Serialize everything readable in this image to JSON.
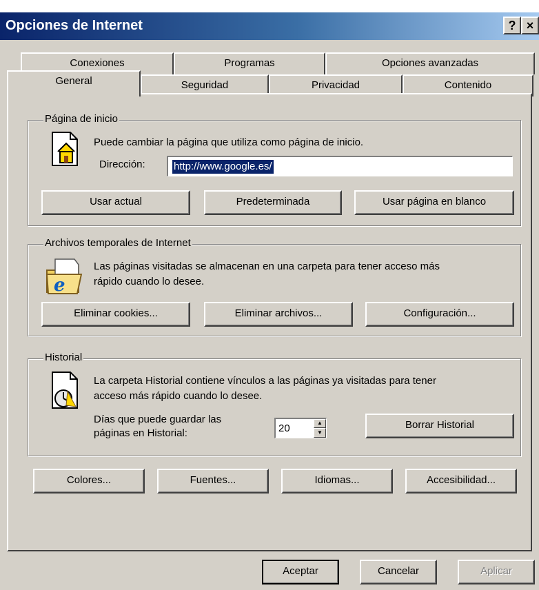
{
  "window": {
    "title": "Opciones de Internet",
    "help_glyph": "?",
    "close_glyph": "×"
  },
  "tabs": {
    "back_row": [
      "Conexiones",
      "Programas",
      "Opciones avanzadas"
    ],
    "front_row": [
      "General",
      "Seguridad",
      "Privacidad",
      "Contenido"
    ],
    "active": "General"
  },
  "home_page": {
    "group_label": "Página de inicio",
    "description": "Puede cambiar la página que utiliza como página de inicio.",
    "address_label": "Dirección:",
    "address_value": "http://www.google.es/",
    "buttons": [
      "Usar actual",
      "Predeterminada",
      "Usar página en blanco"
    ]
  },
  "temp_files": {
    "group_label": "Archivos temporales de Internet",
    "description_line1": "Las páginas visitadas se almacenan en una carpeta para tener acceso más",
    "description_line2": "rápido cuando lo desee.",
    "buttons": [
      "Eliminar cookies...",
      "Eliminar archivos...",
      "Configuración..."
    ]
  },
  "history": {
    "group_label": "Historial",
    "description_line1": "La carpeta Historial contiene vínculos a las páginas ya visitadas para tener",
    "description_line2": "acceso más rápido cuando lo desee.",
    "days_label_line1": "Días que puede guardar las",
    "days_label_line2": "páginas en Historial:",
    "days_value": "20",
    "clear_button": "Borrar Historial"
  },
  "bottom_buttons": [
    "Colores...",
    "Fuentes...",
    "Idiomas...",
    "Accesibilidad..."
  ],
  "dialog_buttons": {
    "ok": "Aceptar",
    "cancel": "Cancelar",
    "apply": "Aplicar"
  },
  "colors": {
    "title_start": "#0a246a",
    "title_end": "#a6caf0",
    "face": "#d4d0c8",
    "selection": "#0a246a"
  }
}
